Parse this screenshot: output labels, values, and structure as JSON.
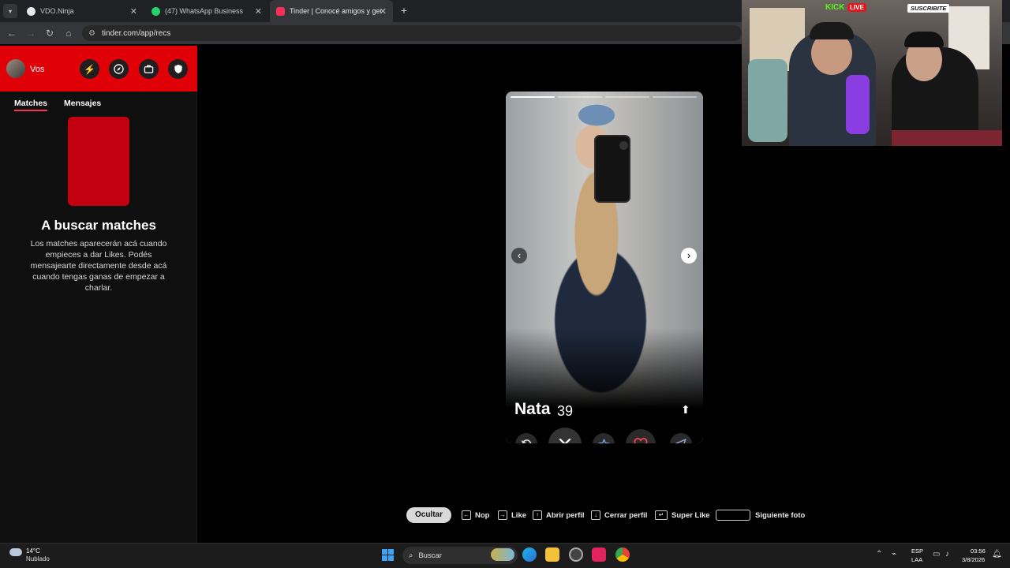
{
  "browser": {
    "tabs": [
      {
        "title": "VDO.Ninja",
        "active": false
      },
      {
        "title": "(47) WhatsApp Business",
        "active": false
      },
      {
        "title": "Tinder | Conocé amigos y gent",
        "active": true
      }
    ],
    "url": "tinder.com/app/recs"
  },
  "sidebar": {
    "user_name": "Vos",
    "tabs": [
      "Matches",
      "Mensajes"
    ],
    "empty_title": "A buscar matches",
    "empty_desc": "Los matches aparecerán acá cuando empieces a dar Likes. Podés mensajearte directamente desde acá cuando tengas ganas de empezar a charlar."
  },
  "profile": {
    "name": "Nata",
    "age": "39",
    "photo_count": 4,
    "current_photo": 1
  },
  "shortcuts": {
    "hide": "Ocultar",
    "nope": "Nop",
    "like": "Like",
    "open_profile": "Abrir perfil",
    "close_profile": "Cerrar perfil",
    "super_like": "Super Like",
    "next_photo": "Siguiente foto"
  },
  "webcam": {
    "kick": "KICK",
    "live": "LIVE",
    "subscribe": "SUSCRIBITE"
  },
  "taskbar": {
    "temp": "14°C",
    "weather": "Nublado",
    "search_placeholder": "Buscar",
    "lang_top": "ESP",
    "lang_bottom": "LAA",
    "time": "03:56",
    "date": "3/8/2026"
  },
  "colors": {
    "tinder_red": "#e00008",
    "like_red": "#ff4458",
    "accent_pink": "#fd2e56"
  }
}
